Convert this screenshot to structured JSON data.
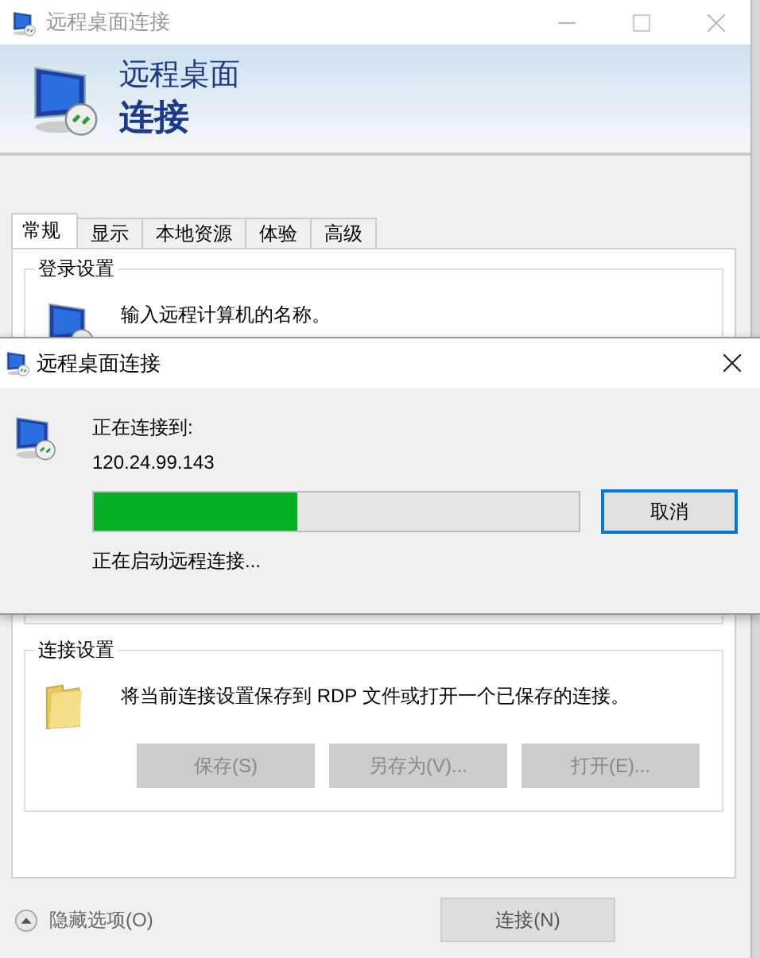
{
  "main_window": {
    "title": "远程桌面连接",
    "banner": {
      "line_1": "远程桌面",
      "line_2": "连接"
    },
    "tabs": [
      {
        "label": "常规",
        "selected": true
      },
      {
        "label": "显示",
        "selected": false
      },
      {
        "label": "本地资源",
        "selected": false
      },
      {
        "label": "体验",
        "selected": false
      },
      {
        "label": "高级",
        "selected": false
      }
    ],
    "login_group": {
      "title": "登录设置",
      "hint": "输入远程计算机的名称。"
    },
    "connection_group": {
      "title": "连接设置",
      "description": "将当前连接设置保存到 RDP 文件或打开一个已保存的连接。",
      "buttons": [
        {
          "label": "保存(S)",
          "disabled": true
        },
        {
          "label": "另存为(V)...",
          "disabled": true
        },
        {
          "label": "打开(E)...",
          "disabled": true
        }
      ]
    },
    "hide_options": "隐藏选项(O)",
    "connect_button": "连接(N)"
  },
  "dialog": {
    "title": "远程桌面连接",
    "connecting_label": "正在连接到:",
    "address": "120.24.99.143",
    "progress": {
      "level": 0.42
    },
    "cancel_button": "取消",
    "status": "正在启动远程连接..."
  }
}
